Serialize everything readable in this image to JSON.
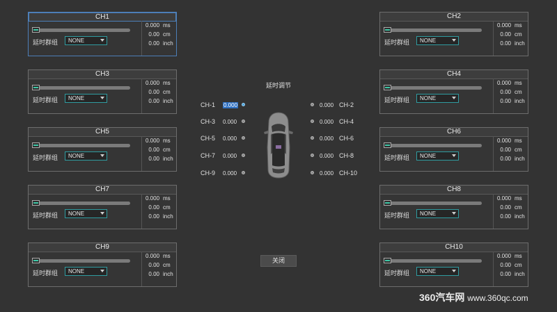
{
  "center": {
    "title": "延时调节",
    "close_label": "关闭",
    "left_channels": [
      {
        "label": "CH-1",
        "value": "0.000",
        "selected": true
      },
      {
        "label": "CH-3",
        "value": "0.000",
        "selected": false
      },
      {
        "label": "CH-5",
        "value": "0.000",
        "selected": false
      },
      {
        "label": "CH-7",
        "value": "0.000",
        "selected": false
      },
      {
        "label": "CH-9",
        "value": "0.000",
        "selected": false
      }
    ],
    "right_channels": [
      {
        "label": "CH-2",
        "value": "0.000"
      },
      {
        "label": "CH-4",
        "value": "0.000"
      },
      {
        "label": "CH-6",
        "value": "0.000"
      },
      {
        "label": "CH-8",
        "value": "0.000"
      },
      {
        "label": "CH-10",
        "value": "0.000"
      }
    ]
  },
  "panels": [
    {
      "title": "CH1",
      "slider": 0,
      "group_label": "延时群组",
      "group_value": "NONE",
      "ms": "0.000",
      "cm": "0.00",
      "inch": "0.00",
      "units": [
        "ms",
        "cm",
        "inch"
      ],
      "active": true
    },
    {
      "title": "CH2",
      "slider": 0,
      "group_label": "延时群组",
      "group_value": "NONE",
      "ms": "0.000",
      "cm": "0.00",
      "inch": "0.00",
      "units": [
        "ms",
        "cm",
        "inch"
      ],
      "active": false
    },
    {
      "title": "CH3",
      "slider": 0,
      "group_label": "延时群组",
      "group_value": "NONE",
      "ms": "0.000",
      "cm": "0.00",
      "inch": "0.00",
      "units": [
        "ms",
        "cm",
        "inch"
      ],
      "active": false
    },
    {
      "title": "CH4",
      "slider": 0,
      "group_label": "延时群组",
      "group_value": "NONE",
      "ms": "0.000",
      "cm": "0.00",
      "inch": "0.00",
      "units": [
        "ms",
        "cm",
        "inch"
      ],
      "active": false
    },
    {
      "title": "CH5",
      "slider": 0,
      "group_label": "延时群组",
      "group_value": "NONE",
      "ms": "0.000",
      "cm": "0.00",
      "inch": "0.00",
      "units": [
        "ms",
        "cm",
        "inch"
      ],
      "active": false
    },
    {
      "title": "CH6",
      "slider": 0,
      "group_label": "延时群组",
      "group_value": "NONE",
      "ms": "0.000",
      "cm": "0.00",
      "inch": "0.00",
      "units": [
        "ms",
        "cm",
        "inch"
      ],
      "active": false
    },
    {
      "title": "CH7",
      "slider": 0,
      "group_label": "延时群组",
      "group_value": "NONE",
      "ms": "0.000",
      "cm": "0.00",
      "inch": "0.00",
      "units": [
        "ms",
        "cm",
        "inch"
      ],
      "active": false
    },
    {
      "title": "CH8",
      "slider": 0,
      "group_label": "延时群组",
      "group_value": "NONE",
      "ms": "0.000",
      "cm": "0.00",
      "inch": "0.00",
      "units": [
        "ms",
        "cm",
        "inch"
      ],
      "active": false
    },
    {
      "title": "CH9",
      "slider": 0,
      "group_label": "延时群组",
      "group_value": "NONE",
      "ms": "0.000",
      "cm": "0.00",
      "inch": "0.00",
      "units": [
        "ms",
        "cm",
        "inch"
      ],
      "active": false
    },
    {
      "title": "CH10",
      "slider": 0,
      "group_label": "延时群组",
      "group_value": "NONE",
      "ms": "0.000",
      "cm": "0.00",
      "inch": "0.00",
      "units": [
        "ms",
        "cm",
        "inch"
      ],
      "active": false
    }
  ],
  "watermark": {
    "brand": "360汽车网",
    "url": "www.360qc.com"
  },
  "colors": {
    "background": "#333333",
    "accent": "#3fc9a8",
    "select_border": "#2f9ca1",
    "selection": "#2e6fc0",
    "active_border": "#4d7fb8"
  }
}
